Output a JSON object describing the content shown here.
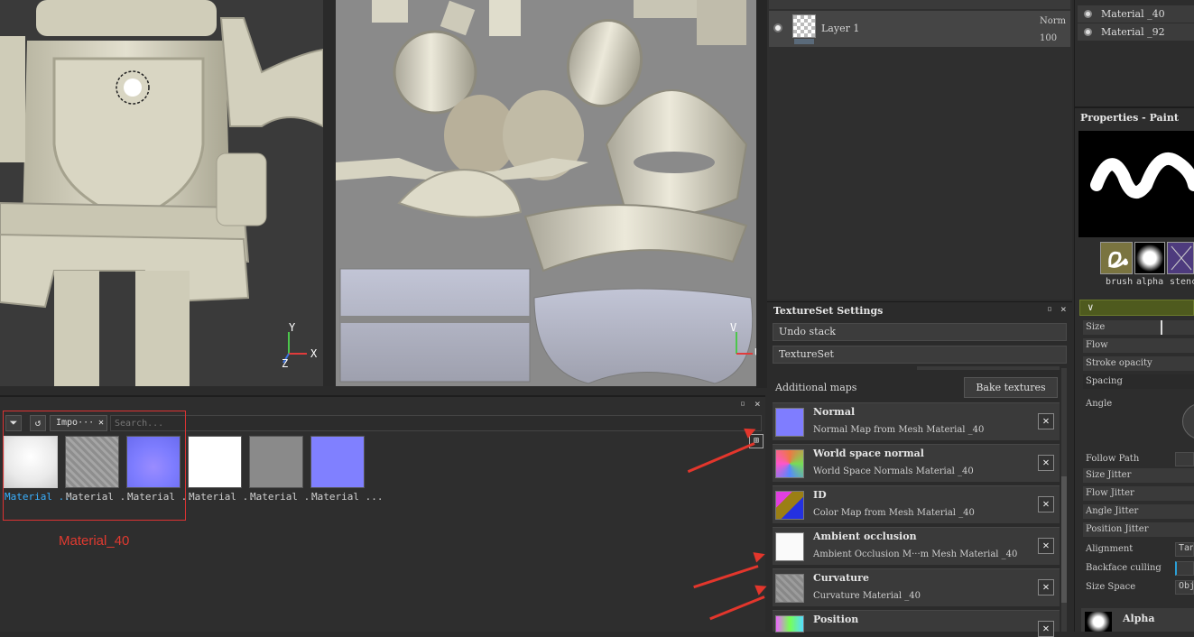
{
  "viewport3d": {
    "axis_y": "Y",
    "axis_x": "X",
    "axis_z": "Z"
  },
  "viewport2d": {
    "axis_v": "V",
    "axis_u": "U"
  },
  "layers": {
    "layer_name": "Layer 1",
    "blend_mode": "Norm",
    "opacity": "100"
  },
  "shelf": {
    "filter_text": "Impo···",
    "search_placeholder": "Search...",
    "items": [
      {
        "label": "Material ..."
      },
      {
        "label": "Material ..."
      },
      {
        "label": "Material ..."
      },
      {
        "label": "Material ..."
      },
      {
        "label": "Material ..."
      },
      {
        "label": "Material ..."
      }
    ],
    "annotation": "Material_40"
  },
  "texture_set": {
    "title": "TextureSet Settings",
    "undo_stack": "Undo stack",
    "texture_set_label": "TextureSet",
    "additional_maps": "Additional maps",
    "bake_button": "Bake textures",
    "maps": [
      {
        "name": "Normal",
        "desc": "Normal Map from Mesh Material _40"
      },
      {
        "name": "World space normal",
        "desc": "World Space Normals Material _40"
      },
      {
        "name": "ID",
        "desc": "Color Map from Mesh Material _40"
      },
      {
        "name": "Ambient occlusion",
        "desc": "Ambient Occlusion M···m Mesh Material _40"
      },
      {
        "name": "Curvature",
        "desc": "Curvature Material _40"
      },
      {
        "name": "Position",
        "desc": ""
      }
    ]
  },
  "materials": [
    "Material _40",
    "Material _92"
  ],
  "properties": {
    "title": "Properties - Paint",
    "brush": "brush",
    "alpha": "alpha",
    "stencil": "stenci",
    "size": "Size",
    "flow": "Flow",
    "stroke_opacity": "Stroke opacity",
    "spacing": "Spacing",
    "angle": "Angle",
    "follow_path": "Follow Path",
    "size_jitter": "Size Jitter",
    "flow_jitter": "Flow Jitter",
    "angle_jitter": "Angle Jitter",
    "position_jitter": "Position Jitter",
    "alignment": "Alignment",
    "alignment_val": "Tan",
    "backface": "Backface culling",
    "size_space": "Size Space",
    "size_space_val": "Obj",
    "alpha_section": "Alpha"
  }
}
